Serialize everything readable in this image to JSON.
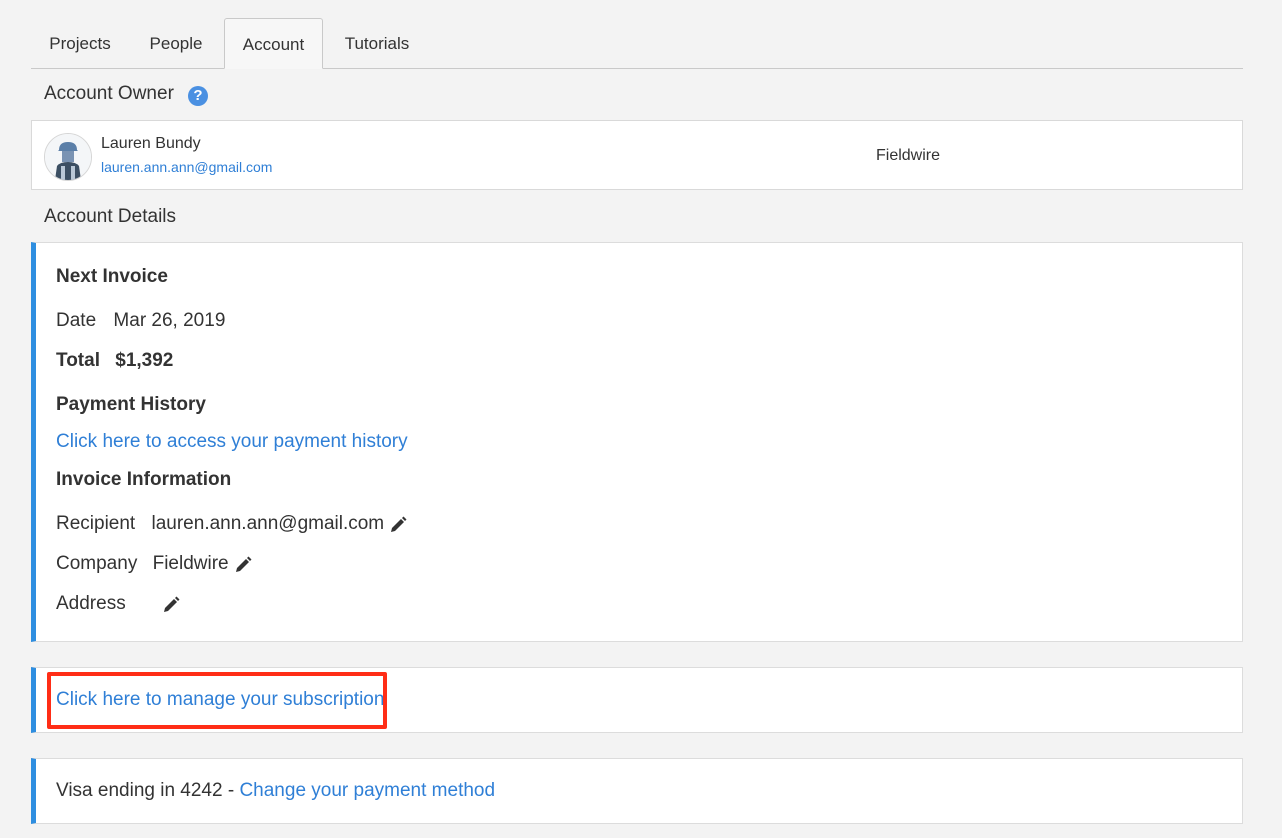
{
  "tabs": [
    {
      "label": "Projects"
    },
    {
      "label": "People"
    },
    {
      "label": "Account"
    },
    {
      "label": "Tutorials"
    }
  ],
  "active_tab": "Account",
  "owner_section": {
    "title": "Account Owner",
    "help_icon": "?"
  },
  "owner": {
    "name": "Lauren Bundy",
    "email": "lauren.ann.ann@gmail.com",
    "company": "Fieldwire"
  },
  "details_section": {
    "title": "Account Details"
  },
  "invoice": {
    "heading": "Next Invoice",
    "date_label": "Date",
    "date_value": "Mar 26, 2019",
    "total_label": "Total",
    "total_value": "$1,392"
  },
  "payment_history": {
    "heading": "Payment History",
    "link": "Click here to access your payment history"
  },
  "invoice_info": {
    "heading": "Invoice Information",
    "recipient_label": "Recipient",
    "recipient_value": "lauren.ann.ann@gmail.com",
    "company_label": "Company",
    "company_value": "Fieldwire",
    "address_label": "Address",
    "address_value": ""
  },
  "subscription": {
    "link": "Click here to manage your subscription"
  },
  "payment_method": {
    "text": "Visa ending in 4242 - ",
    "link": "Change your payment method"
  },
  "colors": {
    "accent": "#2e8ee0",
    "link": "#2f7fd6",
    "highlight": "#ff2d16"
  }
}
